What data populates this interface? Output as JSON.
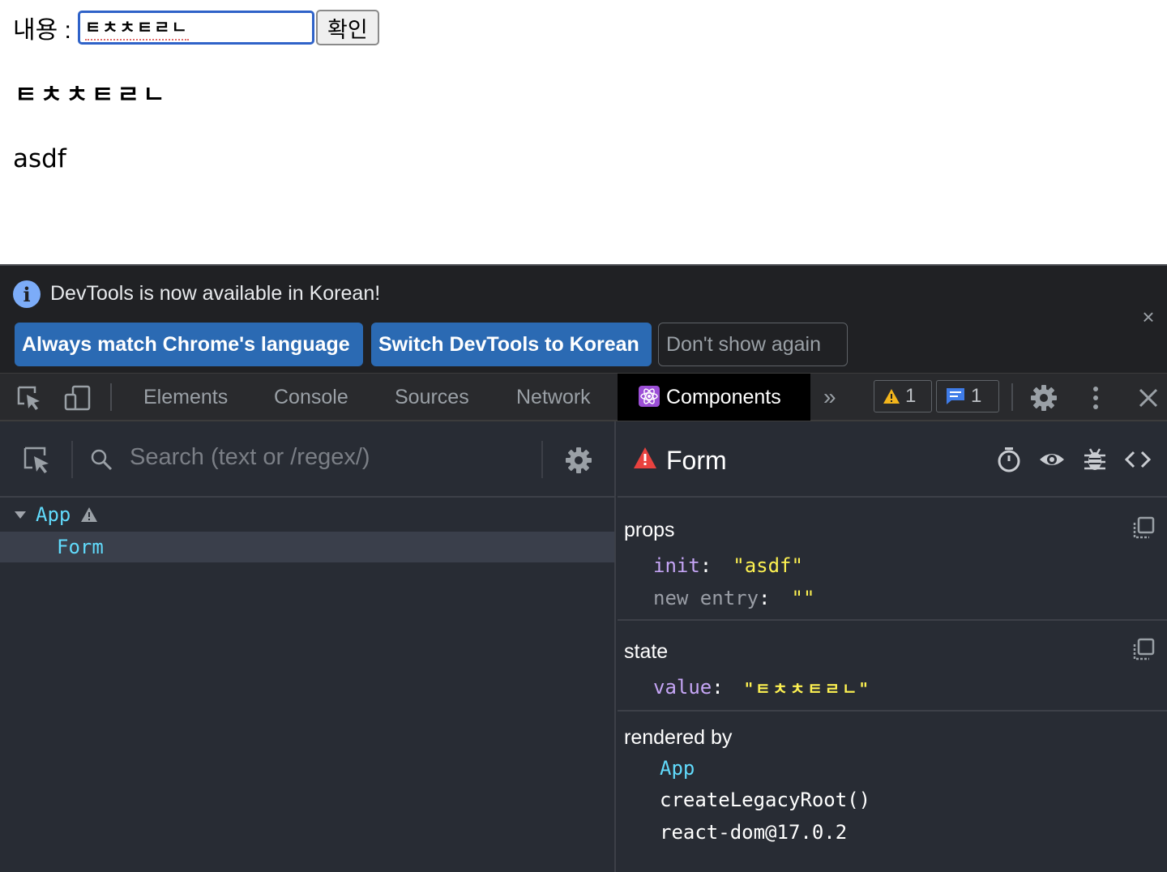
{
  "page": {
    "content_label": "내용 :",
    "input_value": "ㅌㅊㅊㅌㄹㄴ",
    "confirm_button": "확인",
    "value_display": "ㅌㅊㅊㅌㄹㄴ",
    "init_display": "asdf"
  },
  "devtools": {
    "banner": {
      "message": "DevTools is now available in Korean!",
      "info_icon": "i",
      "close_icon": "×",
      "buttons": {
        "match_language": "Always match Chrome's language",
        "switch_korean": "Switch DevTools to Korean",
        "dont_show": "Don't show again"
      }
    },
    "tabs": {
      "elements": "Elements",
      "console": "Console",
      "sources": "Sources",
      "network": "Network",
      "components": "Components",
      "more": "»"
    },
    "badges": {
      "warnings": "1",
      "messages": "1"
    },
    "close_icon": "✕",
    "tree": {
      "search_placeholder": "Search (text or /regex/)",
      "items": [
        {
          "label": "App",
          "has_warning": true
        },
        {
          "label": "Form",
          "selected": true
        }
      ]
    },
    "inspector": {
      "title": "Form",
      "props": {
        "title": "props",
        "rows": [
          {
            "key": "init",
            "value": "\"asdf\""
          },
          {
            "key": "new entry",
            "value": "\"\""
          }
        ]
      },
      "state": {
        "title": "state",
        "rows": [
          {
            "key": "value",
            "value": "\"ㅌㅊㅊㅌㄹㄴ\""
          }
        ]
      },
      "rendered_by": {
        "title": "rendered by",
        "items": [
          "App",
          "createLegacyRoot()",
          "react-dom@17.0.2"
        ]
      }
    },
    "colors": {
      "component_name": "#61dafb",
      "prop_key": "#c5a5f5",
      "string_value": "#fdf151",
      "banner_button": "#2b6ab3"
    }
  }
}
